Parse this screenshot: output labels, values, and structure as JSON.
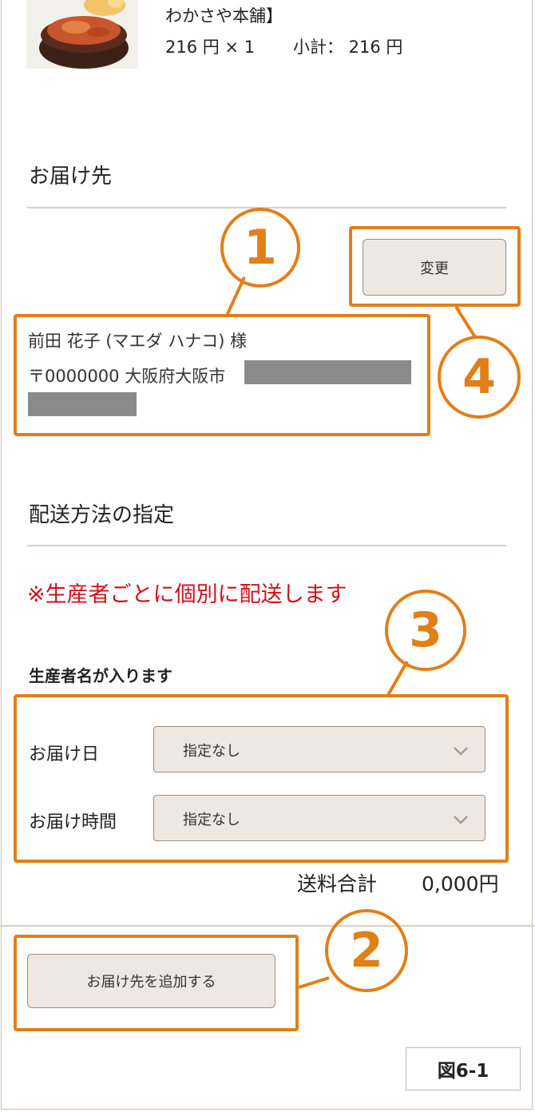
{
  "product": {
    "name_tail": "わかさや本舗】",
    "price_qty": "216 円 × 1",
    "subtotal": "小計： 216 円"
  },
  "delivery": {
    "title": "お届け先",
    "change_button": "変更",
    "recipient_name": "前田 花子 (マエダ ハナコ) 様",
    "address": "〒0000000 大阪府大阪市"
  },
  "shipping_method": {
    "title": "配送方法の指定",
    "notice": "※生産者ごとに個別に配送します",
    "producer_name": "生産者名が入ります",
    "delivery_date": {
      "label": "お届け日",
      "value": "指定なし"
    },
    "delivery_time": {
      "label": "お届け時間",
      "value": "指定なし"
    },
    "shipping_total_label": "送料合計",
    "shipping_total_value": "0,000円"
  },
  "add_destination_button": "お届け先を追加する",
  "annotations": {
    "one": "1",
    "two": "2",
    "three": "3",
    "four": "4"
  },
  "figure_label": "図6-1",
  "colors": {
    "callout": "#e17f18",
    "notice": "#d0101b",
    "button_bg": "#efe8e2"
  },
  "icons": {
    "select_arrow": "chevron-down-icon"
  }
}
